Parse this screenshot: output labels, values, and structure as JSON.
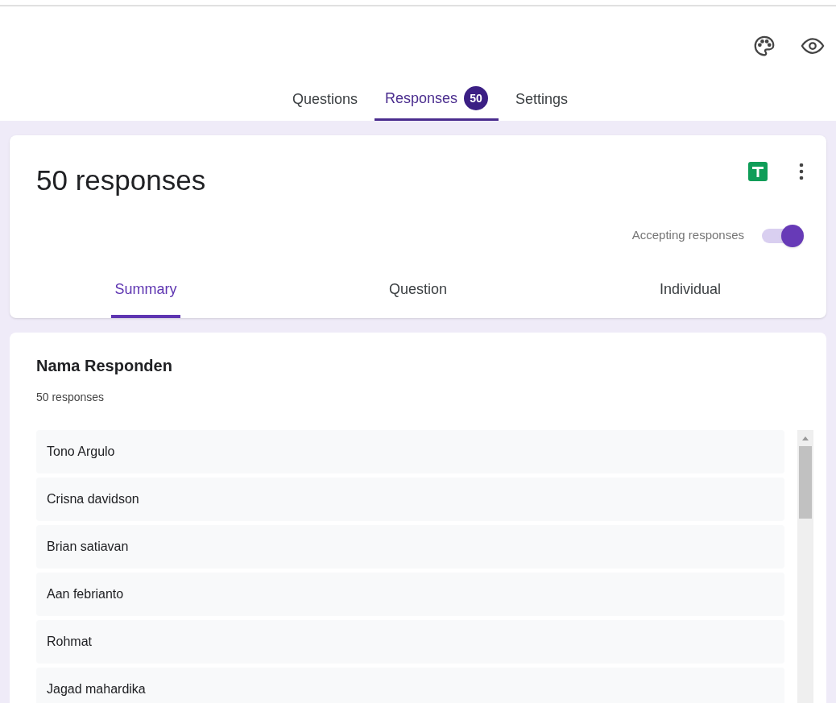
{
  "tabs": [
    {
      "label": "Questions",
      "selected": false
    },
    {
      "label": "Responses",
      "badge": "50",
      "selected": true
    },
    {
      "label": "Settings",
      "selected": false
    }
  ],
  "header": {
    "title": "50 responses",
    "accepting": {
      "label": "Accepting responses",
      "on": true
    }
  },
  "view_tabs": [
    {
      "label": "Summary",
      "selected": true
    },
    {
      "label": "Question",
      "selected": false
    },
    {
      "label": "Individual",
      "selected": false
    }
  ],
  "question": {
    "title": "Nama Responden",
    "count": "50 responses",
    "answers": [
      "Tono Argulo",
      "Crisna davidson",
      "Brian satiavan",
      "Aan febrianto",
      "Rohmat",
      "Jagad mahardika"
    ]
  }
}
